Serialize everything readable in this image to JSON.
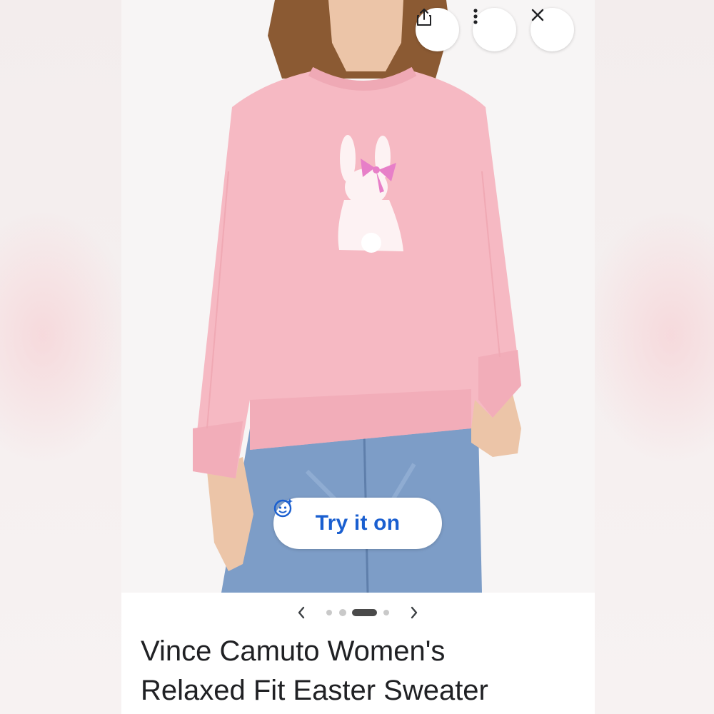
{
  "product": {
    "title_line1": "Vince Camuto Women's",
    "title_line2": "Relaxed Fit Easter Sweater"
  },
  "actions": {
    "share_icon": "share-icon",
    "more_icon": "more-vert-icon",
    "close_icon": "close-icon"
  },
  "try_on": {
    "label": "Try it on",
    "icon": "face-sparkle-icon"
  },
  "carousel": {
    "image_count": 5,
    "active_index": 2,
    "prev_icon": "chevron-left-icon",
    "next_icon": "chevron-right-icon"
  },
  "colors": {
    "accent": "#1a5fd0",
    "sweater": "#f6b9c3",
    "jeans": "#7d9dc7"
  }
}
